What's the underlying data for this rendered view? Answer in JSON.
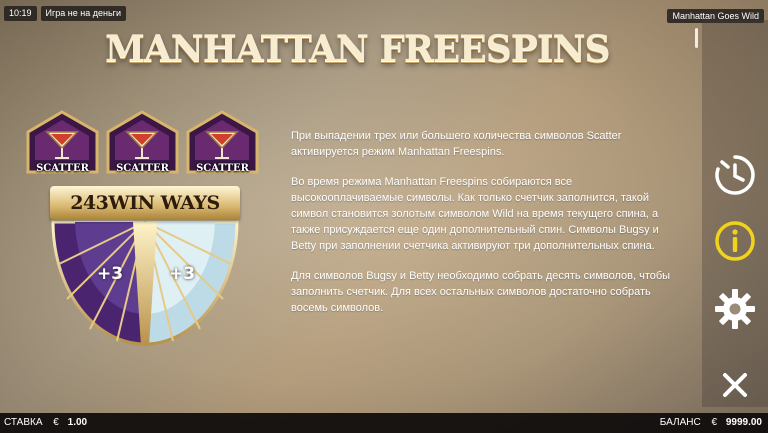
{
  "top_bar": {
    "time": "10:19",
    "mode": "Игра не на деньги",
    "game_name": "Manhattan Goes Wild"
  },
  "title": "MANHATTAN FREESPINS",
  "illustration": {
    "scatter_label": "SCATTER",
    "banner": "243WIN WAYS",
    "plus_left": "+3",
    "plus_right": "+3"
  },
  "description": [
    "При выпадении трех или большего количества символов Scatter активируется режим Manhattan Freespins.",
    "Во время режима Manhattan Freespins собираются все высокооплачиваемые символы. Как только счетчик заполнится, такой символ становится золотым символом Wild на время текущего спина, а также присуждается еще один дополнительный спин. Символы Bugsy и Betty при заполнении счетчика активируют три дополнительных спина.",
    "Для символов Bugsy и Betty необходимо собрать десять символов, чтобы заполнить счетчик. Для всех остальных символов достаточно собрать восемь символов."
  ],
  "sidebar": {
    "icons": [
      "history-icon",
      "info-icon",
      "settings-gear-icon",
      "close-icon"
    ],
    "active_color": "#f2d31b"
  },
  "bottom_bar": {
    "bet_label": "СТАВКА",
    "bet_currency": "€",
    "bet_value": "1.00",
    "balance_label": "БАЛАНС",
    "balance_currency": "€",
    "balance_value": "9999.00"
  }
}
